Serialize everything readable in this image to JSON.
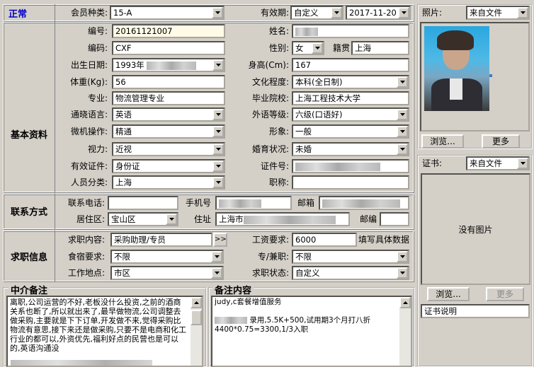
{
  "status": "正常",
  "top": {
    "member_type_label": "会员种类:",
    "member_type": "15-A",
    "validity_label": "有效期:",
    "validity_mode": "自定义",
    "validity_date": "2017-11-20"
  },
  "sections": {
    "basic": "基本资料",
    "contact": "联系方式",
    "job": "求职信息",
    "agent_note": "中介备注",
    "note": "备注内容"
  },
  "basic": {
    "id_label": "编号:",
    "id": "20161121007",
    "name_label": "姓名:",
    "code_label": "编码:",
    "code": "CXF",
    "gender_label": "性别:",
    "gender": "女",
    "native_label": "籍贯",
    "native": "上海",
    "birth_label": "出生日期:",
    "birth": "1993年",
    "height_label": "身高(Cm):",
    "height": "167",
    "weight_label": "体重(Kg):",
    "weight": "56",
    "edu_label": "文化程度:",
    "edu": "本科(全日制)",
    "major_label": "专业:",
    "major": "物流管理专业",
    "school_label": "毕业院校:",
    "school": "上海工程技术大学",
    "lang_label": "通晓语言:",
    "lang": "英语",
    "foreign_label": "外语等级:",
    "foreign": "六级(口语好)",
    "pc_label": "微机操作:",
    "pc": "精通",
    "image_label": "形象:",
    "image": "一般",
    "vision_label": "视力:",
    "vision": "近视",
    "marriage_label": "婚育状况:",
    "marriage": "未婚",
    "cert_label": "有效证件:",
    "cert": "身份证",
    "cert_no_label": "证件号:",
    "category_label": "人员分类:",
    "category": "上海",
    "title_label": "职称:"
  },
  "contact": {
    "phone_label": "联系电话:",
    "mobile_label": "手机号",
    "email_label": "邮箱",
    "district_label": "居住区:",
    "district": "宝山区",
    "address_label": "住址",
    "address": "上海市",
    "zip_label": "邮编"
  },
  "job": {
    "intent_label": "求职内容:",
    "intent": "采购助理/专员",
    "more_arrow": ">>",
    "salary_label": "工资要求:",
    "salary": "6000",
    "salary_hint": "填写具体数据",
    "board_label": "食宿要求:",
    "board": "不限",
    "parttime_label": "专/兼职:",
    "parttime": "不限",
    "location_label": "工作地点:",
    "location": "市区",
    "state_label": "求职状态:",
    "state": "自定义"
  },
  "agent_note": "离职,公司运营的不好,老板没什么投资,之前的酒商关系也断了,所以就出来了,最早做物流,公司调整去做采购,主要就是下下订单,开发做不来,觉得采购比物流有意思,接下来还是做采购,只要不是电商和化工行业的都可以,外资优先,福利好点的民营也是可以的,英语沟通没",
  "note": {
    "line1": "judy,c套餐增值服务",
    "line2": "录用,5.5K+500,试用期3个月打八折",
    "line3": "4400*0.75=3300,1/3入职"
  },
  "photo": {
    "label": "照片:",
    "source": "来自文件",
    "browse": "浏览...",
    "more": "更多"
  },
  "certificate": {
    "label": "证书:",
    "source": "来自文件",
    "empty": "没有图片",
    "browse": "浏览...",
    "more": "更多",
    "desc": "证书说明"
  }
}
